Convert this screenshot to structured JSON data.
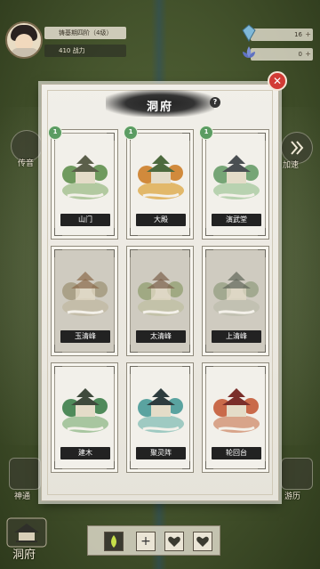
{
  "player": {
    "name": "铸基期四阶（4级）",
    "power": "410 战力"
  },
  "resources": [
    {
      "icon": "crystal-icon",
      "value": "16"
    },
    {
      "icon": "lotus-icon",
      "value": "0"
    }
  ],
  "side_buttons": {
    "left_upper": "传音",
    "right_upper": "加速",
    "left_lower": "神通",
    "right_lower": "游历",
    "bottom_home": "洞府"
  },
  "modal": {
    "title": "洞府",
    "help": "?",
    "close": "✕",
    "buildings": [
      {
        "label": "山门",
        "level": "1",
        "locked": false,
        "roof": "#5b5f4a",
        "tree": "#6f9a5e",
        "ground": "#b2c9a0"
      },
      {
        "label": "大殿",
        "level": "1",
        "locked": false,
        "roof": "#4d6a3e",
        "tree": "#d18a3c",
        "ground": "#e2b86a"
      },
      {
        "label": "演武堂",
        "level": "1",
        "locked": false,
        "roof": "#4a4f52",
        "tree": "#76a576",
        "ground": "#b8d2b0"
      },
      {
        "label": "玉清峰",
        "level": "",
        "locked": true,
        "roof": "#8a6a4a",
        "tree": "#9a8f70",
        "ground": "#bfb7a0"
      },
      {
        "label": "太清峰",
        "level": "",
        "locked": true,
        "roof": "#7a5f4a",
        "tree": "#8c9a6a",
        "ground": "#bdbda0"
      },
      {
        "label": "上清峰",
        "level": "",
        "locked": true,
        "roof": "#5f6558",
        "tree": "#8f9a7c",
        "ground": "#bcbcac"
      },
      {
        "label": "建木",
        "level": "",
        "locked": false,
        "roof": "#3f4a3c",
        "tree": "#4f8a5a",
        "ground": "#a8c6a0"
      },
      {
        "label": "聚灵阵",
        "level": "",
        "locked": false,
        "roof": "#2e3c3e",
        "tree": "#5aa3a0",
        "ground": "#9fcac2"
      },
      {
        "label": "轮回台",
        "level": "",
        "locked": false,
        "roof": "#7a2e2a",
        "tree": "#c96a4a",
        "ground": "#d8a48a"
      }
    ]
  },
  "bottom_bar": {
    "slot_plus": "+"
  },
  "colors": {
    "close_red": "#d23b35",
    "level_badge": "#5b9c62",
    "label_plate": "#222222"
  }
}
